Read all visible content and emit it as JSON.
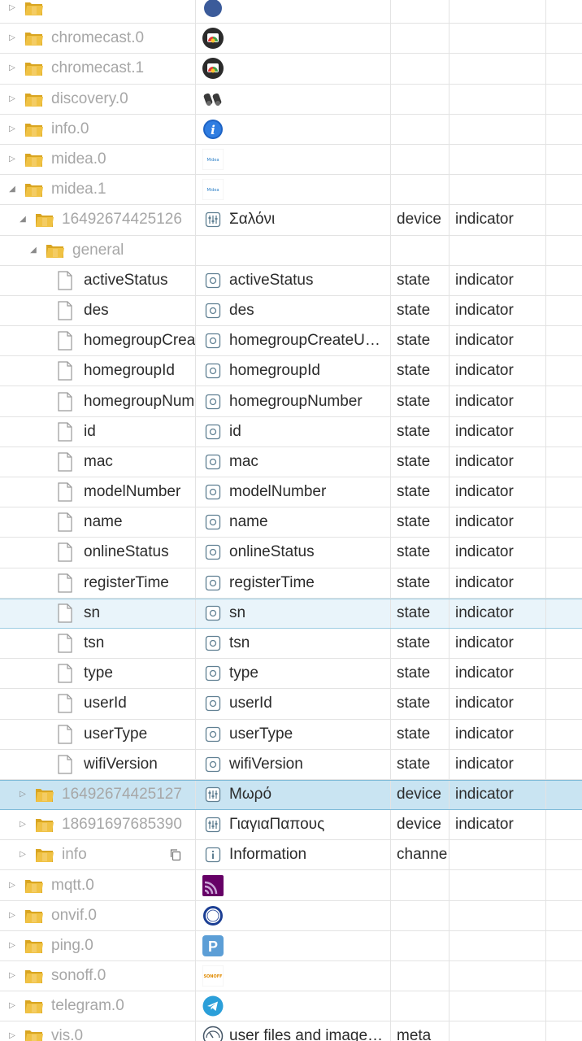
{
  "rows": [
    {
      "level": 0,
      "kind": "folder",
      "toggle": "collapsed",
      "label": "",
      "icon": "adapter-icon",
      "name": "",
      "type": "",
      "role": "",
      "style": "topcut"
    },
    {
      "level": 0,
      "kind": "folder",
      "toggle": "collapsed",
      "label": "chromecast.0",
      "icon": "chromecast-icon",
      "name": "",
      "type": "",
      "role": ""
    },
    {
      "level": 0,
      "kind": "folder",
      "toggle": "collapsed",
      "label": "chromecast.1",
      "icon": "chromecast-icon",
      "name": "",
      "type": "",
      "role": ""
    },
    {
      "level": 0,
      "kind": "folder",
      "toggle": "collapsed",
      "label": "discovery.0",
      "icon": "binoculars-icon",
      "name": "",
      "type": "",
      "role": ""
    },
    {
      "level": 0,
      "kind": "folder",
      "toggle": "collapsed",
      "label": "info.0",
      "icon": "info-icon",
      "name": "",
      "type": "",
      "role": ""
    },
    {
      "level": 0,
      "kind": "folder",
      "toggle": "collapsed",
      "label": "midea.0",
      "icon": "midea-icon",
      "name": "",
      "type": "",
      "role": ""
    },
    {
      "level": 0,
      "kind": "folder",
      "toggle": "expanded",
      "label": "midea.1",
      "icon": "midea-icon",
      "name": "",
      "type": "",
      "role": ""
    },
    {
      "level": 1,
      "kind": "folder",
      "toggle": "expanded",
      "label": "16492674425126",
      "icon": "device-icon",
      "name": "Σαλόνι",
      "type": "device",
      "role": "indicator",
      "labelDark": false
    },
    {
      "level": 2,
      "kind": "folder",
      "toggle": "expanded",
      "label": "general",
      "icon": "",
      "name": "",
      "type": "",
      "role": ""
    },
    {
      "level": 3,
      "kind": "file",
      "label": "activeStatus",
      "icon": "state-icon",
      "name": "activeStatus",
      "type": "state",
      "role": "indicator"
    },
    {
      "level": 3,
      "kind": "file",
      "label": "des",
      "icon": "state-icon",
      "name": "des",
      "type": "state",
      "role": "indicator"
    },
    {
      "level": 3,
      "kind": "file",
      "label": "homegroupCreateUserId",
      "icon": "state-icon",
      "name": "homegroupCreateUserId",
      "type": "state",
      "role": "indicator"
    },
    {
      "level": 3,
      "kind": "file",
      "label": "homegroupId",
      "icon": "state-icon",
      "name": "homegroupId",
      "type": "state",
      "role": "indicator"
    },
    {
      "level": 3,
      "kind": "file",
      "label": "homegroupNumber",
      "icon": "state-icon",
      "name": "homegroupNumber",
      "type": "state",
      "role": "indicator"
    },
    {
      "level": 3,
      "kind": "file",
      "label": "id",
      "icon": "state-icon",
      "name": "id",
      "type": "state",
      "role": "indicator"
    },
    {
      "level": 3,
      "kind": "file",
      "label": "mac",
      "icon": "state-icon",
      "name": "mac",
      "type": "state",
      "role": "indicator"
    },
    {
      "level": 3,
      "kind": "file",
      "label": "modelNumber",
      "icon": "state-icon",
      "name": "modelNumber",
      "type": "state",
      "role": "indicator"
    },
    {
      "level": 3,
      "kind": "file",
      "label": "name",
      "icon": "state-icon",
      "name": "name",
      "type": "state",
      "role": "indicator"
    },
    {
      "level": 3,
      "kind": "file",
      "label": "onlineStatus",
      "icon": "state-icon",
      "name": "onlineStatus",
      "type": "state",
      "role": "indicator"
    },
    {
      "level": 3,
      "kind": "file",
      "label": "registerTime",
      "icon": "state-icon",
      "name": "registerTime",
      "type": "state",
      "role": "indicator"
    },
    {
      "level": 3,
      "kind": "file",
      "label": "sn",
      "icon": "state-icon",
      "name": "sn",
      "type": "state",
      "role": "indicator",
      "style": "hl-light"
    },
    {
      "level": 3,
      "kind": "file",
      "label": "tsn",
      "icon": "state-icon",
      "name": "tsn",
      "type": "state",
      "role": "indicator"
    },
    {
      "level": 3,
      "kind": "file",
      "label": "type",
      "icon": "state-icon",
      "name": "type",
      "type": "state",
      "role": "indicator"
    },
    {
      "level": 3,
      "kind": "file",
      "label": "userId",
      "icon": "state-icon",
      "name": "userId",
      "type": "state",
      "role": "indicator"
    },
    {
      "level": 3,
      "kind": "file",
      "label": "userType",
      "icon": "state-icon",
      "name": "userType",
      "type": "state",
      "role": "indicator"
    },
    {
      "level": 3,
      "kind": "file",
      "label": "wifiVersion",
      "icon": "state-icon",
      "name": "wifiVersion",
      "type": "state",
      "role": "indicator"
    },
    {
      "level": 1,
      "kind": "folder",
      "toggle": "collapsed",
      "label": "16492674425127",
      "icon": "device-icon",
      "name": "Μωρό",
      "type": "device",
      "role": "indicator",
      "style": "hl-dark"
    },
    {
      "level": 1,
      "kind": "folder",
      "toggle": "collapsed",
      "label": "18691697685390",
      "icon": "device-icon",
      "name": "ΓιαγιαΠαπους",
      "type": "device",
      "role": "indicator"
    },
    {
      "level": 1,
      "kind": "folder",
      "toggle": "collapsed",
      "label": "info",
      "icon": "channel-info-icon",
      "name": "Information",
      "type": "channe",
      "role": "",
      "copy": true
    },
    {
      "level": 0,
      "kind": "folder",
      "toggle": "collapsed",
      "label": "mqtt.0",
      "icon": "mqtt-icon",
      "name": "",
      "type": "",
      "role": ""
    },
    {
      "level": 0,
      "kind": "folder",
      "toggle": "collapsed",
      "label": "onvif.0",
      "icon": "onvif-icon",
      "name": "",
      "type": "",
      "role": ""
    },
    {
      "level": 0,
      "kind": "folder",
      "toggle": "collapsed",
      "label": "ping.0",
      "icon": "ping-icon",
      "name": "",
      "type": "",
      "role": ""
    },
    {
      "level": 0,
      "kind": "folder",
      "toggle": "collapsed",
      "label": "sonoff.0",
      "icon": "sonoff-icon",
      "name": "",
      "type": "",
      "role": ""
    },
    {
      "level": 0,
      "kind": "folder",
      "toggle": "collapsed",
      "label": "telegram.0",
      "icon": "telegram-icon",
      "name": "",
      "type": "",
      "role": ""
    },
    {
      "level": 0,
      "kind": "folder",
      "toggle": "collapsed",
      "label": "vis.0",
      "icon": "vis-icon",
      "name": "user files and images for vis",
      "type": "meta",
      "role": ""
    }
  ],
  "brand_logos": {
    "midea": "Midea",
    "sonoff": "SONOFF"
  },
  "colors": {
    "folder": "#e9b830",
    "highlight_light": "#e9f4fa",
    "highlight_dark": "#c9e4f2",
    "grey_text": "#a7a7a7"
  }
}
